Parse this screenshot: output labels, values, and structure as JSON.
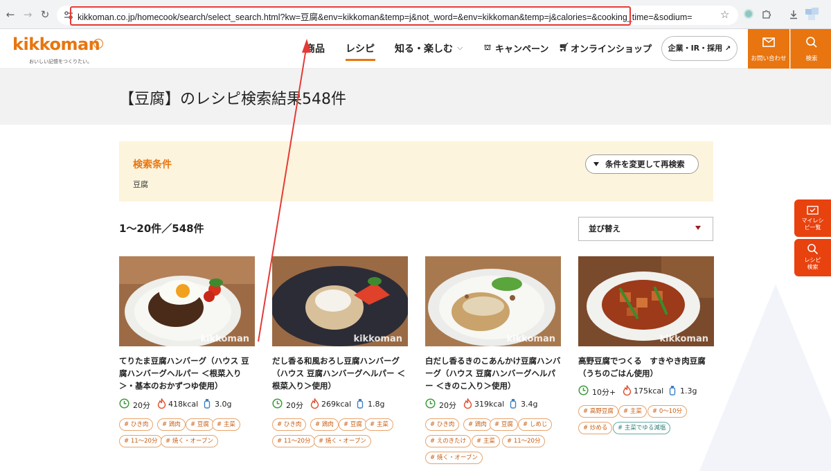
{
  "browser": {
    "url": "kikkoman.co.jp/homecook/search/select_search.html?kw=豆腐&env=kikkoman&temp=j&not_word=&env=kikkoman&temp=j&calories=&cooking_time=&sodium=",
    "back_icon": "arrow-left-icon",
    "forward_icon": "arrow-right-icon",
    "reload_icon": "reload-icon",
    "bookmark_icon": "star-icon",
    "annotation_color": "#e53935"
  },
  "header": {
    "logo_text": "kikkoman",
    "logo_tagline": "おいしい記憶をつくりたい。",
    "nav": [
      "商品",
      "レシピ",
      "知る・楽しむ",
      "キャンペーン",
      "オンラインショップ"
    ],
    "nav_active": "レシピ",
    "corporate_button": "企業・IR・採用",
    "contact_label": "お問い合わせ",
    "search_label": "検索",
    "accent_color": "#e8750f"
  },
  "page": {
    "title": "【豆腐】のレシピ検索結果548件",
    "conditions_title": "検索条件",
    "conditions_value": "豆腐",
    "re_search_button": "条件を変更して再検索",
    "count_text": "1〜20件／548件",
    "sort_label": "並び替え"
  },
  "side_buttons": {
    "my_recipes": "マイレシピ一覧",
    "recipe_search": "レシピ検索"
  },
  "cards": [
    {
      "title": "てりたま豆腐ハンバーグ（ハウス 豆腐ハンバーグヘルパー ＜根菜入り＞・基本のおかずつゆ使用）",
      "time": "20分",
      "kcal": "418kcal",
      "salt": "3.0g",
      "tags": [
        "# ひき肉",
        "# 鶏肉",
        "# 豆腐",
        "# 主菜",
        "# 11〜20分",
        "# 焼く・オーブン"
      ],
      "watermark": "kikkoman"
    },
    {
      "title": "だし香る和風おろし豆腐ハンバーグ（ハウス 豆腐ハンバーグヘルパー ＜根菜入り＞使用）",
      "time": "20分",
      "kcal": "269kcal",
      "salt": "1.8g",
      "tags": [
        "# ひき肉",
        "# 鶏肉",
        "# 豆腐",
        "# 主菜",
        "# 11〜20分",
        "# 焼く・オーブン"
      ],
      "watermark": "kikkoman"
    },
    {
      "title": "白だし香るきのこあんかけ豆腐ハンバーグ（ハウス 豆腐ハンバーグヘルパー ＜きのこ入り＞使用）",
      "time": "20分",
      "kcal": "319kcal",
      "salt": "3.4g",
      "tags": [
        "# ひき肉",
        "# 鶏肉",
        "# 豆腐",
        "# しめじ",
        "# えのきたけ",
        "# 主菜",
        "# 11〜20分",
        "# 焼く・オーブン"
      ],
      "watermark": "kikkoman"
    },
    {
      "title": "高野豆腐でつくる　すきやき肉豆腐（うちのごはん使用）",
      "time": "10分+",
      "kcal": "175kcal",
      "salt": "1.3g",
      "tags": [
        "# 高野豆腐",
        "# 主菜",
        "# 0〜10分",
        "# 炒める",
        "# 主菜でゆる減塩"
      ],
      "watermark": "kikkoman"
    }
  ]
}
